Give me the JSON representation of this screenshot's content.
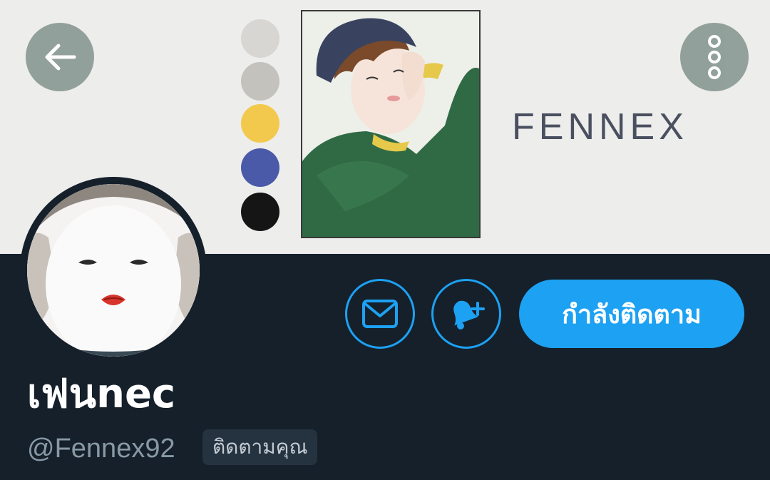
{
  "header": {
    "back_icon": "arrow-left-icon",
    "more_icon": "more-vertical-icon"
  },
  "banner": {
    "brand_text": "FENNEX",
    "swatches": [
      "#d8d6d3",
      "#c4c2bd",
      "#f2c94c",
      "#4a5aa8",
      "#151515"
    ]
  },
  "profile": {
    "display_name": "เฟนnec",
    "handle": "@Fennex92",
    "follows_you_badge": "ติดตามคุณ"
  },
  "actions": {
    "message_icon": "mail-icon",
    "notify_icon": "bell-plus-icon",
    "following_label": "กำลังติดตาม"
  },
  "colors": {
    "background": "#15202b",
    "accent": "#1da1f2",
    "secondary_text": "#8899a6"
  }
}
